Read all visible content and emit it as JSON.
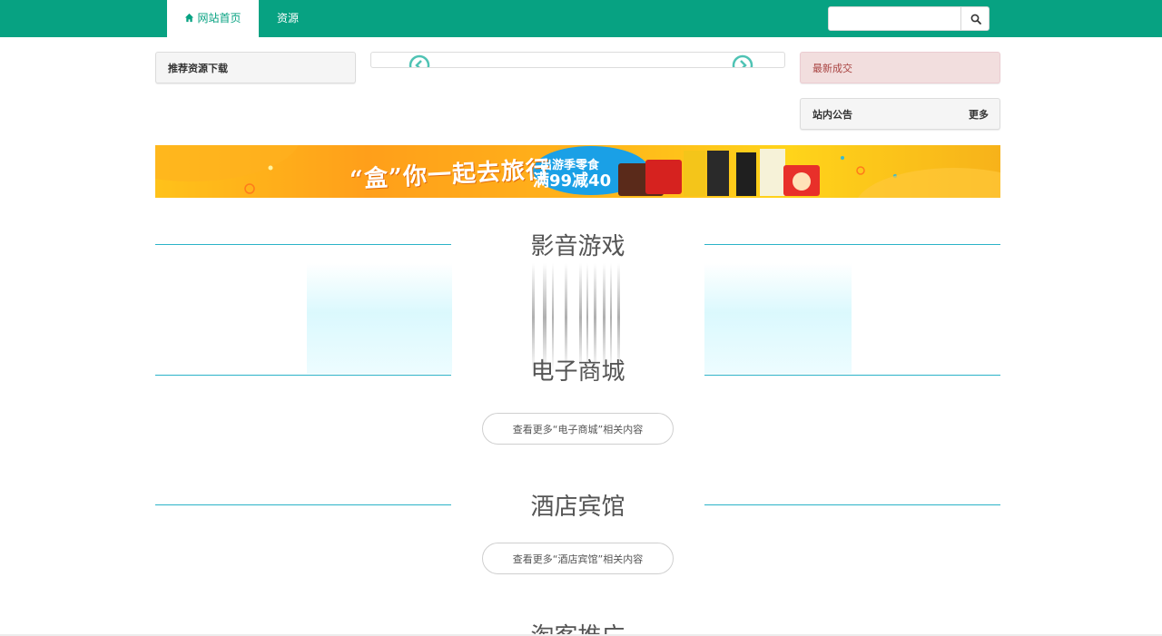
{
  "nav": {
    "home_label": "网站首页",
    "resources_label": "资源"
  },
  "search": {
    "placeholder": "",
    "value": ""
  },
  "panels": {
    "recommended_title": "推荐资源下载",
    "latest_deals_title": "最新成交",
    "notice_title": "站内公告",
    "notice_more": "更多"
  },
  "banner": {
    "alt": "广告横幅",
    "slogan": "“盒”你一起去旅行",
    "promo_line1": "出游季零食",
    "promo_line2": "满99减40"
  },
  "sections": [
    {
      "title": "影音游戏",
      "more_label": ""
    },
    {
      "title": "电子商城",
      "more_label": "查看更多“电子商城”相关内容"
    },
    {
      "title": "酒店宾馆",
      "more_label": "查看更多“酒店宾馆”相关内容"
    },
    {
      "title": "淘客推广",
      "more_label": ""
    }
  ],
  "colors": {
    "brand": "#07a282",
    "section_line": "#2bb3c8",
    "latest_bg": "#f2dede",
    "latest_text": "#a94442"
  }
}
